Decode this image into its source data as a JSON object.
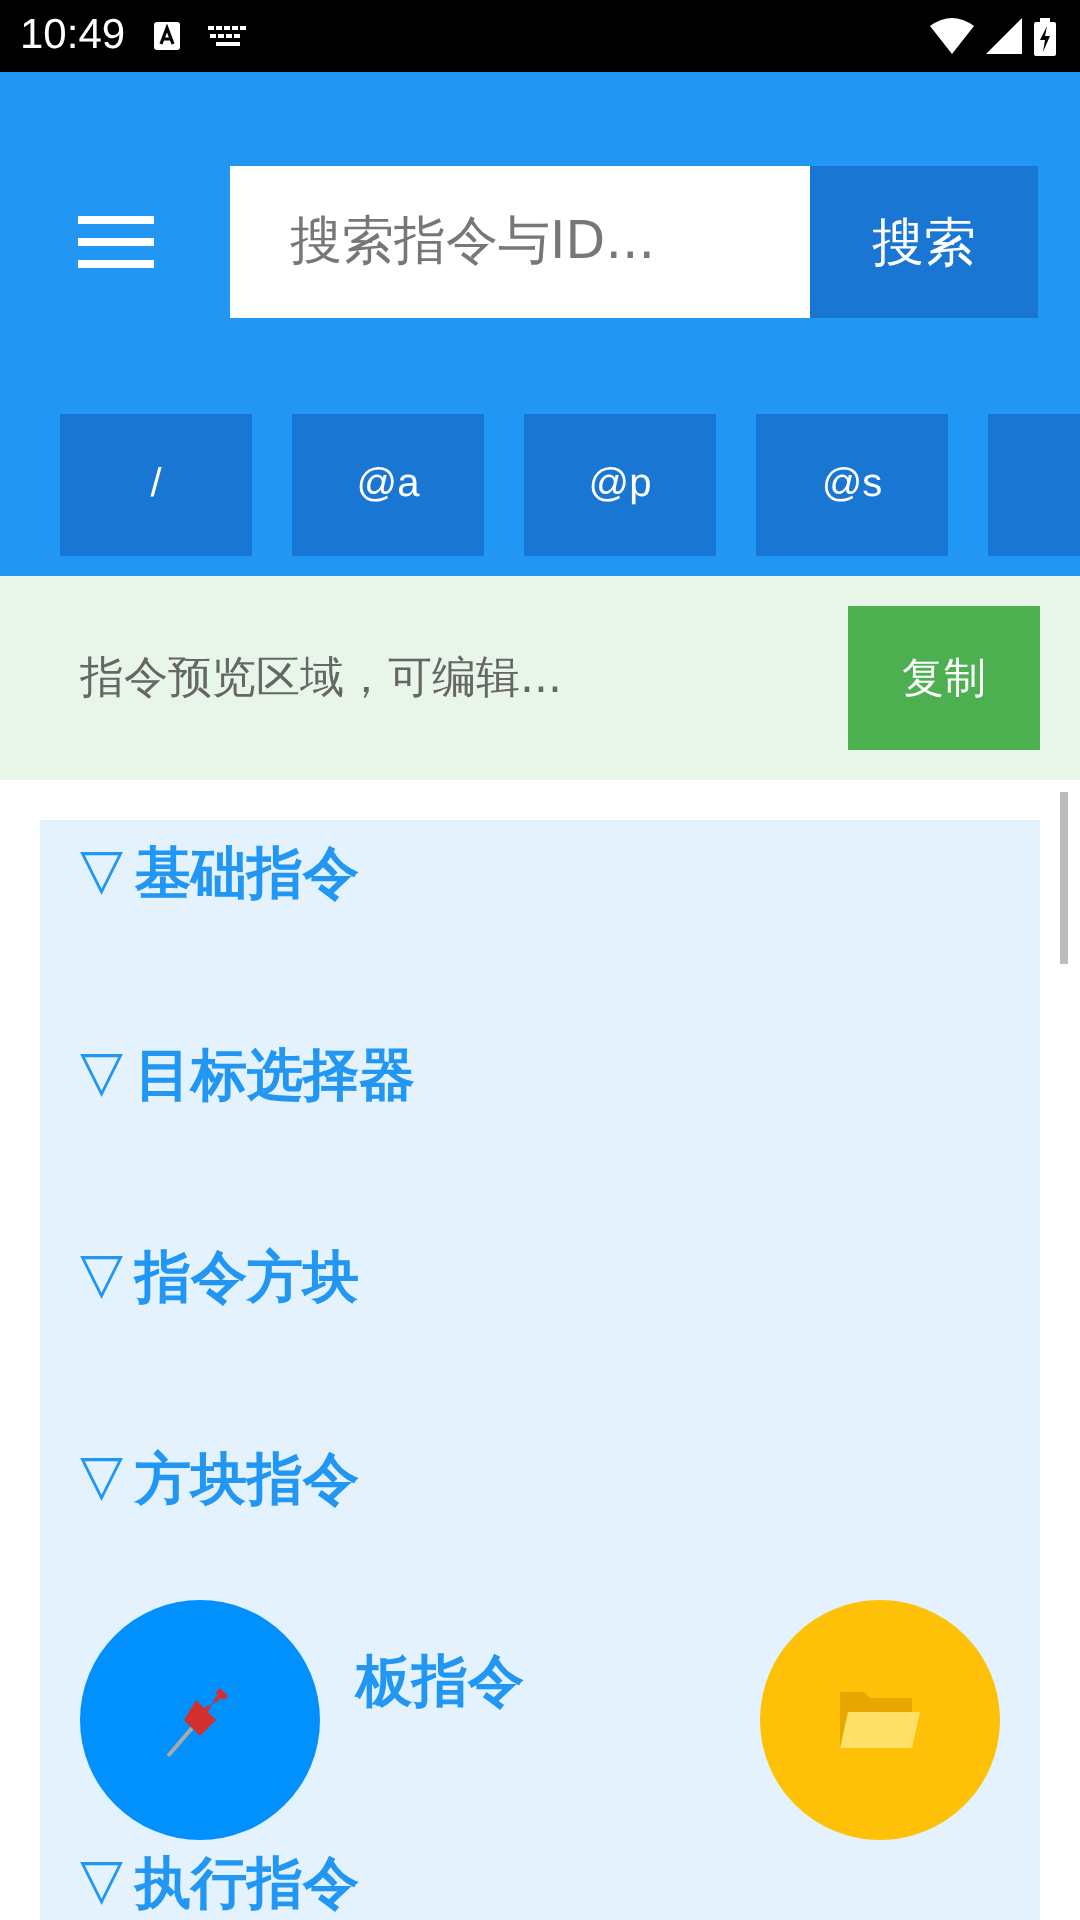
{
  "status_bar": {
    "time": "10:49"
  },
  "search": {
    "placeholder": "搜索指令与ID...",
    "button": "搜索"
  },
  "selector_chips": [
    {
      "label": "/"
    },
    {
      "label": "@a"
    },
    {
      "label": "@p"
    },
    {
      "label": "@s"
    },
    {
      "kind": "cut"
    }
  ],
  "preview": {
    "placeholder": "指令预览区域，可编辑...",
    "copy_button": "复制"
  },
  "categories": [
    {
      "marker": "▽",
      "label": "基础指令"
    },
    {
      "marker": "▽",
      "label": "目标选择器"
    },
    {
      "marker": "▽",
      "label": "指令方块"
    },
    {
      "marker": "▽",
      "label": "方块指令"
    },
    {
      "kind": "covered",
      "label": "板指令"
    },
    {
      "marker": "▽",
      "label": "执行指令"
    }
  ]
}
